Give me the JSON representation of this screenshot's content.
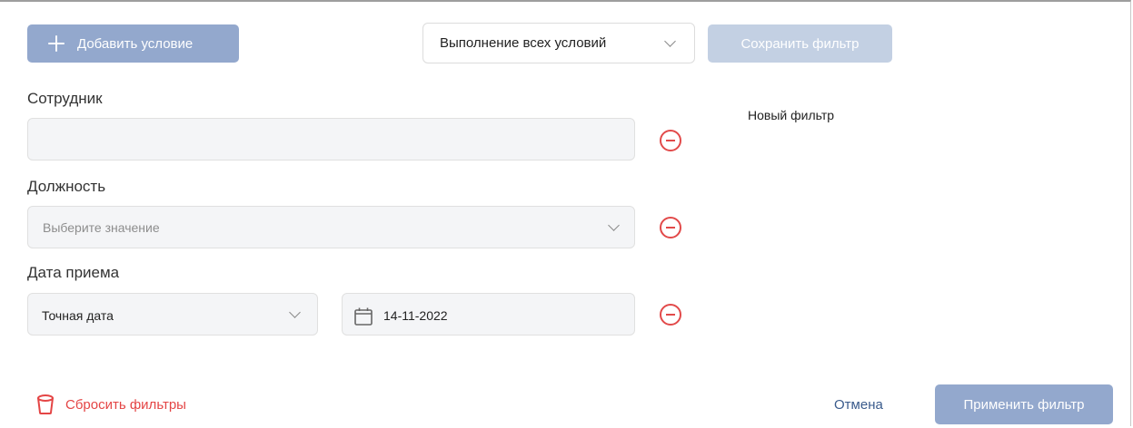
{
  "toolbar": {
    "add_condition_label": "Добавить условие",
    "match_mode_value": "Выполнение всех условий",
    "save_filter_label": "Сохранить фильтр"
  },
  "conditions": [
    {
      "label": "Сотрудник",
      "value": ""
    },
    {
      "label": "Должность",
      "placeholder": "Выберите значение"
    },
    {
      "label": "Дата приема",
      "mode_value": "Точная дата",
      "date_value": "14-11-2022"
    }
  ],
  "saved_filters": {
    "new_filter_label": "Новый фильтр"
  },
  "footer": {
    "reset_label": "Сбросить фильтры",
    "cancel_label": "Отмена",
    "apply_label": "Применить фильтр"
  },
  "colors": {
    "primary_button": "#93a8cd",
    "disabled_button": "#c3d0e3",
    "danger": "#e24a4a",
    "link": "#3a5b8c"
  },
  "icons": [
    "plus-icon",
    "chevron-down-icon",
    "remove-condition-icon",
    "calendar-icon",
    "trash-icon"
  ]
}
